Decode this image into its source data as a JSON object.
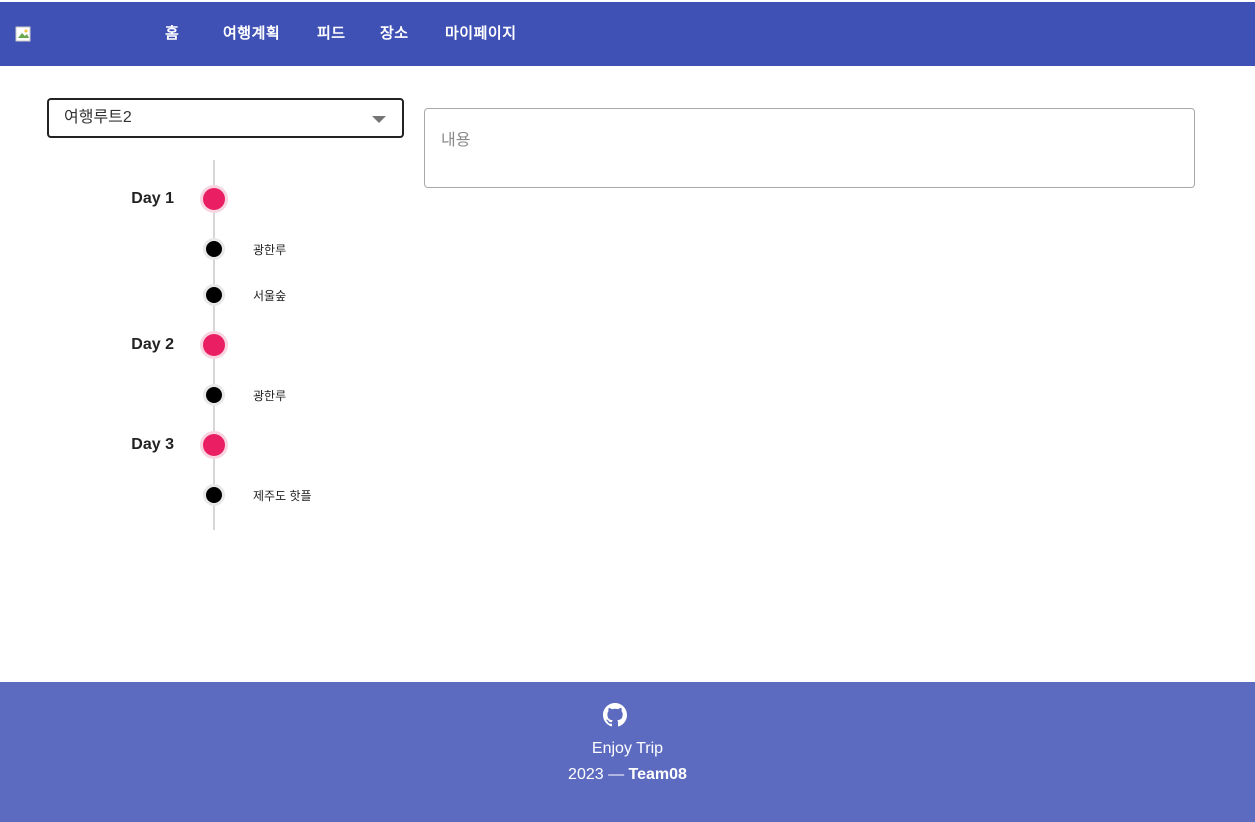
{
  "header": {
    "logo_alt": "logo",
    "nav": [
      {
        "label": "홈"
      },
      {
        "label": "여행계획"
      },
      {
        "label": "피드"
      },
      {
        "label": "장소"
      },
      {
        "label": "마이페이지"
      }
    ]
  },
  "route_select": {
    "selected": "여행루트2"
  },
  "content_field": {
    "placeholder": "내용"
  },
  "timeline": {
    "days": [
      {
        "label": "Day 1",
        "places": [
          "광한루",
          "서울숲"
        ]
      },
      {
        "label": "Day 2",
        "places": [
          "광한루"
        ]
      },
      {
        "label": "Day 3",
        "places": [
          "제주도 핫플"
        ]
      }
    ]
  },
  "footer": {
    "icon": "github-icon",
    "title": "Enjoy Trip",
    "copy_prefix": "2023 — ",
    "team": "Team08"
  },
  "colors": {
    "header": "#3f51b5",
    "footer": "#5c6bc0",
    "day_dot": "#e91e63",
    "place_dot": "#000000"
  }
}
